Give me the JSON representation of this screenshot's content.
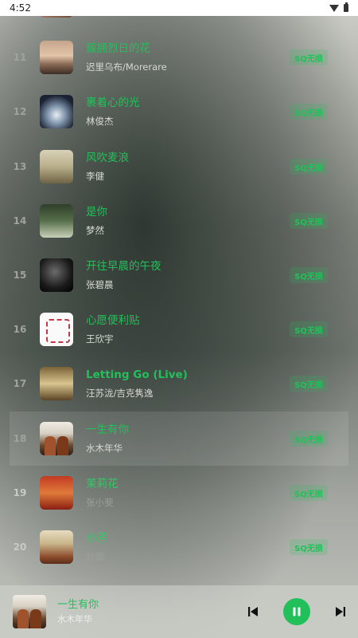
{
  "status_bar": {
    "time": "4:52"
  },
  "badge_label": "SQ无损",
  "tracks": [
    {
      "index": "11",
      "title": "簇拥烈日的花",
      "artist": "迟里乌布/Morerare"
    },
    {
      "index": "12",
      "title": "裹着心的光",
      "artist": "林俊杰"
    },
    {
      "index": "13",
      "title": "风吹麦浪",
      "artist": "李健"
    },
    {
      "index": "14",
      "title": "是你",
      "artist": "梦然"
    },
    {
      "index": "15",
      "title": "开往早晨的午夜",
      "artist": "张碧晨"
    },
    {
      "index": "16",
      "title": "心愿便利贴",
      "artist": "王欣宇"
    },
    {
      "index": "17",
      "title": "Letting Go (Live)",
      "artist": "汪苏泷/吉克隽逸"
    },
    {
      "index": "18",
      "title": "一生有你",
      "artist": "水木年华"
    },
    {
      "index": "19",
      "title": "茉莉花",
      "artist": "张小斐"
    },
    {
      "index": "20",
      "title": "小芳",
      "artist": "赵雷"
    }
  ],
  "now_playing": {
    "title": "一生有你",
    "artist": "水木年华"
  },
  "colors": {
    "accent": "#22c05a"
  }
}
